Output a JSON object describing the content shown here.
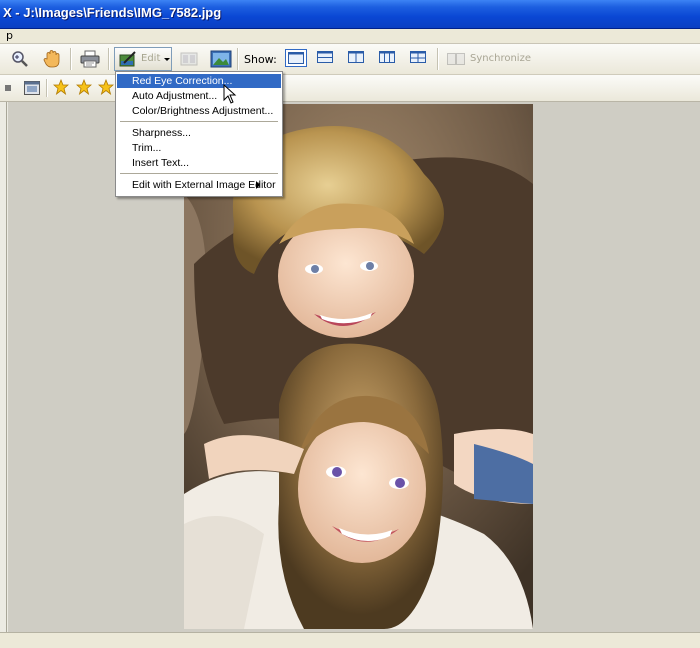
{
  "window": {
    "title": "X - J:\\Images\\Friends\\IMG_7582.jpg"
  },
  "menubar": {
    "items": [
      "p"
    ]
  },
  "toolbar": {
    "edit_label": "Edit",
    "show_label": "Show:",
    "synchronize_label": "Synchronize",
    "icons": [
      "zoom-icon",
      "hand-tool-icon",
      "print-icon",
      "edit-icon",
      "dropdown-arrow-icon",
      "slideshow-icon",
      "image-icon"
    ],
    "view_modes": [
      "single-view",
      "horizontal-split",
      "vertical-split",
      "three-columns",
      "four-grid"
    ],
    "active_view": "single-view"
  },
  "toolbar2": {
    "icons": [
      "panel-icon",
      "window-icon",
      "star-icon",
      "star-icon",
      "star-icon"
    ]
  },
  "edit_menu": {
    "items": [
      {
        "label": "Red Eye Correction...",
        "selected": true
      },
      {
        "label": "Auto Adjustment...",
        "selected": false
      },
      {
        "label": "Color/Brightness Adjustment...",
        "selected": false
      },
      {
        "label": "Sharpness...",
        "selected": false
      },
      {
        "label": "Trim...",
        "selected": false
      },
      {
        "label": "Insert Text...",
        "selected": false
      },
      {
        "label": "Edit with External Image Editor",
        "selected": false,
        "submenu": true
      }
    ]
  },
  "colors": {
    "titlebar": "#0a47d4",
    "selection": "#316ac5",
    "viewport_bg": "#cfcdc4"
  }
}
